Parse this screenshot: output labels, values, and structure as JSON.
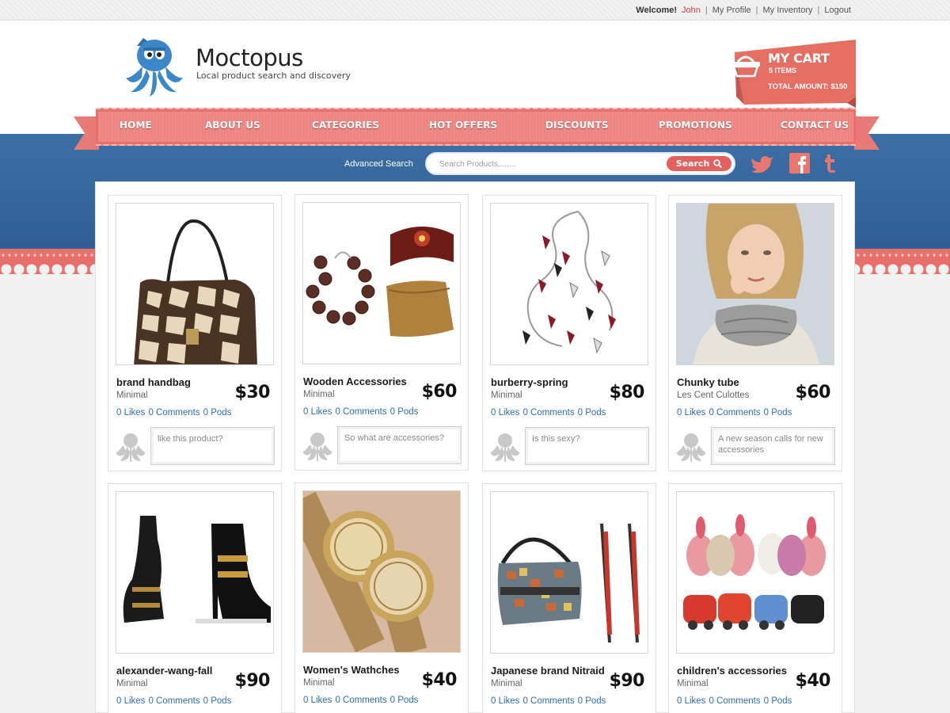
{
  "topbar": {
    "welcome": "Welcome!",
    "user": "John",
    "sep": "|",
    "my_profile": "My Profile",
    "my_inventory": "My Inventory",
    "logout": "Logout"
  },
  "logo": {
    "title": "Moctopus",
    "tagline": "Local product search and discovery"
  },
  "cart": {
    "title": "MY CART",
    "items": "5 ITEMS",
    "total": "TOTAL AMOUNT: $150"
  },
  "nav": [
    "HOME",
    "ABOUT US",
    "CATEGORIES",
    "HOT OFFERS",
    "DISCOUNTS",
    "PROMOTIONS",
    "CONTACT US"
  ],
  "search": {
    "advanced": "Advanced Search",
    "placeholder": "Search Products........",
    "button": "Search"
  },
  "social": [
    "twitter-icon",
    "facebook-icon",
    "tumblr-icon"
  ],
  "colors": {
    "accent": "#e4605c",
    "nav": "#ee8582",
    "blue": "#2e5e94",
    "link": "#2d6fad"
  },
  "products": [
    {
      "name": "brand handbag",
      "sub": "Minimal",
      "price": "$30",
      "likes": "0 Likes",
      "comments": "0 Comments",
      "pods": "0 Pods",
      "comment": "like this product?"
    },
    {
      "name": "Wooden Accessories",
      "sub": "Minimal",
      "price": "$60",
      "likes": "0 Likes",
      "comments": "0 Comments",
      "pods": "0 Pods",
      "comment": "So what are accessories?"
    },
    {
      "name": "burberry-spring",
      "sub": "Minimal",
      "price": "$80",
      "likes": "0 Likes",
      "comments": "0 Comments",
      "pods": "0 Pods",
      "comment": "Is this sexy?"
    },
    {
      "name": "Chunky tube",
      "sub": "Les Cent Culottes",
      "price": "$60",
      "likes": "0 Likes",
      "comments": "0 Comments",
      "pods": "0 Pods",
      "comment": "A new season calls for new accessories"
    },
    {
      "name": "alexander-wang-fall",
      "sub": "Minimal",
      "price": "$90",
      "likes": "0 Likes",
      "comments": "0 Comments",
      "pods": "0 Pods"
    },
    {
      "name": "Women's Wathches",
      "sub": "Minimal",
      "price": "$40",
      "likes": "0 Likes",
      "comments": "0 Comments",
      "pods": "0 Pods"
    },
    {
      "name": "Japanese brand Nitraid",
      "sub": "Minimal",
      "price": "$90",
      "likes": "0 Likes",
      "comments": "0 Comments",
      "pods": "0 Pods"
    },
    {
      "name": "children's accessories",
      "sub": "Minimal",
      "price": "$40",
      "likes": "0 Likes",
      "comments": "0 Comments",
      "pods": "0 Pods"
    }
  ]
}
